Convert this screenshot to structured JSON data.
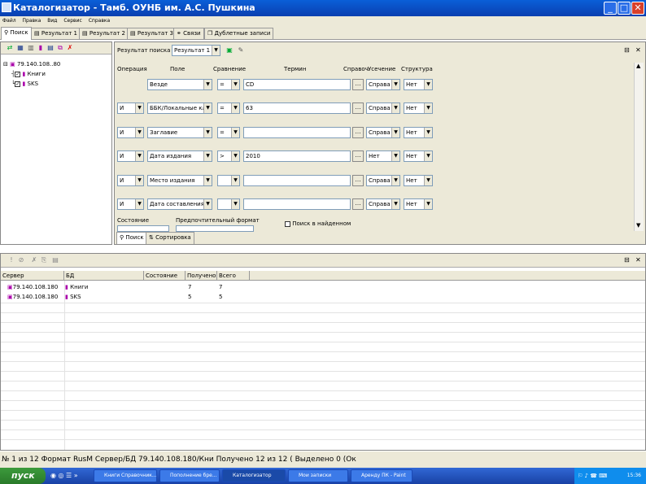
{
  "window": {
    "title": "Каталогизатор - Тамб. ОУНБ им. А.С. Пушкина"
  },
  "menu": [
    "Файл",
    "Правка",
    "Вид",
    "Сервис",
    "Справка"
  ],
  "tabs": [
    "Поиск",
    "Результат 1",
    "Результат 2",
    "Результат 3",
    "Связи",
    "Дублетные записи"
  ],
  "tree": {
    "server": "79.140.108..80",
    "databases": [
      "Книги",
      "SKS"
    ]
  },
  "search": {
    "result_label": "Результат поиска",
    "result_value": "Результат 1",
    "headers": [
      "Операция",
      "Поле",
      "Сравнение",
      "Термин",
      "Справоч.",
      "Усечение",
      "Структура"
    ],
    "rows": [
      {
        "op": "",
        "field": "Везде",
        "cmp": "=",
        "term": "CD",
        "trunc": "Справа",
        "struct": "Нет"
      },
      {
        "op": "И",
        "field": "ББК/Локальные клас",
        "cmp": "=",
        "term": "63",
        "trunc": "Справа",
        "struct": "Нет"
      },
      {
        "op": "И",
        "field": "Заглавие",
        "cmp": "=",
        "term": "",
        "trunc": "Справа",
        "struct": "Нет"
      },
      {
        "op": "И",
        "field": "Дата издания",
        "cmp": ">",
        "term": "2010",
        "trunc": "Нет",
        "struct": "Нет"
      },
      {
        "op": "И",
        "field": "Место издания",
        "cmp": "",
        "term": "",
        "trunc": "Справа",
        "struct": "Нет"
      },
      {
        "op": "И",
        "field": "Дата составления за",
        "cmp": "",
        "term": "",
        "trunc": "Справа",
        "struct": "Нет"
      }
    ],
    "state_label": "Состояние",
    "format_label": "Предпочтительный формат",
    "found_checkbox": "Поиск в найденном",
    "subtabs": [
      "Поиск",
      "Сортировка"
    ]
  },
  "results": {
    "columns": [
      "Сервер",
      "БД",
      "Состояние",
      "Получено",
      "Всего"
    ],
    "rows": [
      {
        "server": "79.140.108.180",
        "db": "Книги",
        "state": "",
        "received": "7",
        "total": "7"
      },
      {
        "server": "79.140.108.180",
        "db": "SKS",
        "state": "",
        "received": "5",
        "total": "5"
      }
    ]
  },
  "status": "№ 1 из 12  Формат RusM Сервер/БД 79.140.108.180/Кни Получено 12 из 12 ( Выделено 0 (Ок",
  "taskbar": {
    "start": "пуск",
    "buttons": [
      "Книги Справочник...",
      "Пополнение бре...",
      "Каталогизатор",
      "Мои записки",
      "Аренду ПК - Paint"
    ],
    "clock": "15:36"
  }
}
